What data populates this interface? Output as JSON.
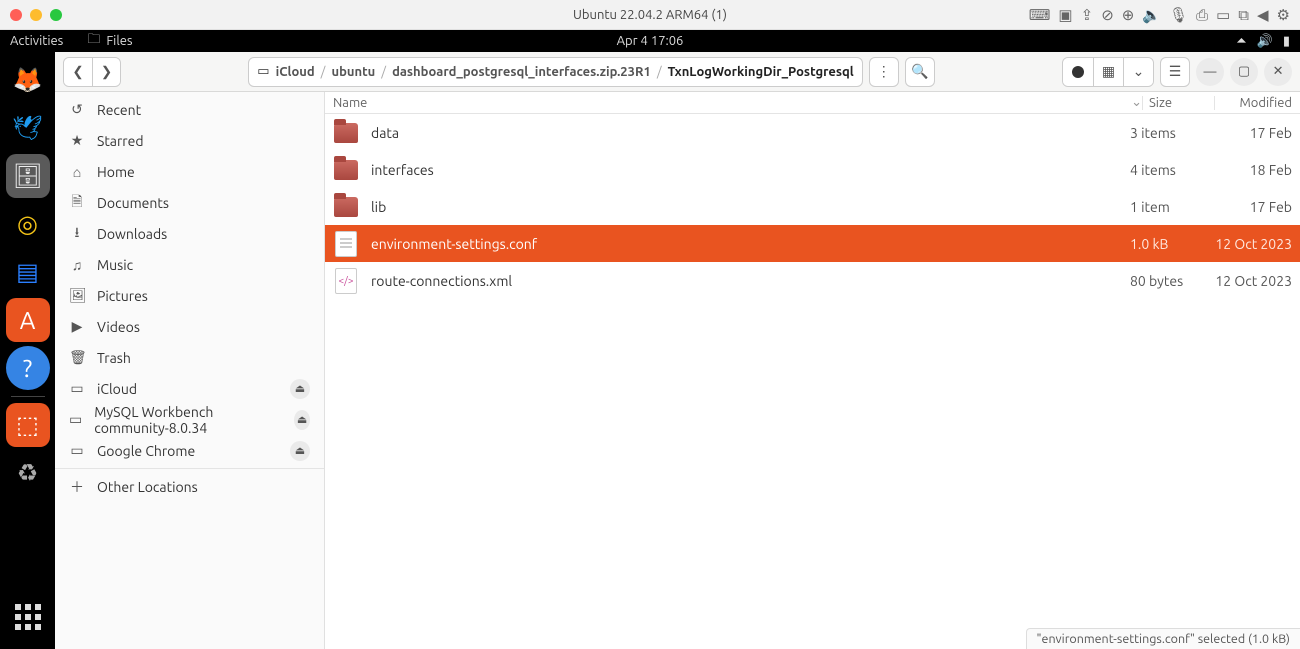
{
  "mac": {
    "title": "Ubuntu 22.04.2 ARM64 (1)"
  },
  "gnome": {
    "activities": "Activities",
    "app_label": "Files",
    "clock": "Apr 4  17:06"
  },
  "breadcrumb": {
    "segments": [
      {
        "label": "iCloud"
      },
      {
        "label": "ubuntu"
      },
      {
        "label": "dashboard_postgresql_interfaces.zip.23R1"
      },
      {
        "label": "TxnLogWorkingDir_Postgresql"
      }
    ]
  },
  "columns": {
    "name": "Name",
    "size": "Size",
    "modified": "Modified"
  },
  "sidebar": {
    "recent": "Recent",
    "starred": "Starred",
    "home": "Home",
    "documents": "Documents",
    "downloads": "Downloads",
    "music": "Music",
    "pictures": "Pictures",
    "videos": "Videos",
    "trash": "Trash",
    "icloud": "iCloud",
    "mysql": "MySQL Workbench community-8.0.34",
    "chrome": "Google Chrome",
    "other": "Other Locations"
  },
  "rows": [
    {
      "name": "data",
      "size": "3 items",
      "modified": "17 Feb",
      "kind": "folder",
      "selected": false
    },
    {
      "name": "interfaces",
      "size": "4 items",
      "modified": "18 Feb",
      "kind": "folder",
      "selected": false
    },
    {
      "name": "lib",
      "size": "1 item",
      "modified": "17 Feb",
      "kind": "folder",
      "selected": false
    },
    {
      "name": "environment-settings.conf",
      "size": "1.0 kB",
      "modified": "12 Oct 2023",
      "kind": "txt",
      "selected": true
    },
    {
      "name": "route-connections.xml",
      "size": "80 bytes",
      "modified": "12 Oct 2023",
      "kind": "xml",
      "selected": false
    }
  ],
  "status": {
    "text": "\"environment-settings.conf\" selected  (1.0 kB)"
  }
}
